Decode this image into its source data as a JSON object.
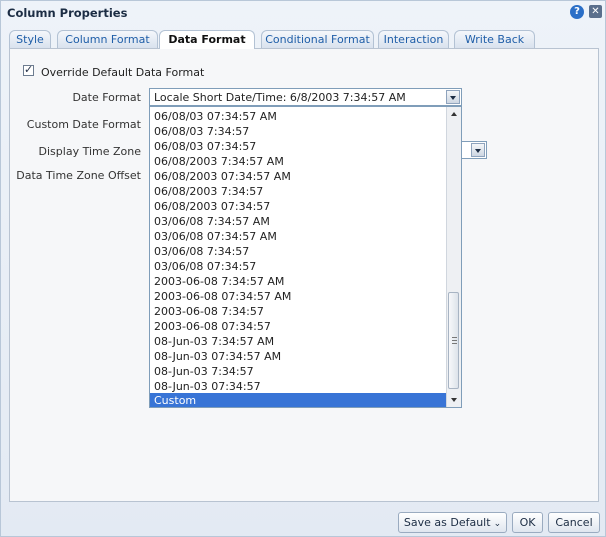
{
  "dialog": {
    "title": "Column Properties"
  },
  "tabs": [
    {
      "label": "Style"
    },
    {
      "label": "Column Format"
    },
    {
      "label": "Data Format"
    },
    {
      "label": "Conditional Format"
    },
    {
      "label": "Interaction"
    },
    {
      "label": "Write Back"
    }
  ],
  "active_tab": "Data Format",
  "override": {
    "label": "Override Default Data Format",
    "checked": true
  },
  "fields": {
    "date_format_label": "Date Format",
    "custom_date_format_label": "Custom Date Format",
    "display_time_zone_label": "Display Time Zone",
    "data_time_zone_offset_label": "Data Time Zone Offset"
  },
  "date_format": {
    "selected": "Locale Short Date/Time: 6/8/2003 7:34:57 AM"
  },
  "dropdown": {
    "options": [
      "06/08/03 07:34:57 AM",
      "06/08/03 7:34:57",
      "06/08/03 07:34:57",
      "06/08/2003 7:34:57 AM",
      "06/08/2003 07:34:57 AM",
      "06/08/2003 7:34:57",
      "06/08/2003 07:34:57",
      "03/06/08 7:34:57 AM",
      "03/06/08 07:34:57 AM",
      "03/06/08 7:34:57",
      "03/06/08 07:34:57",
      "2003-06-08 7:34:57 AM",
      "2003-06-08 07:34:57 AM",
      "2003-06-08 7:34:57",
      "2003-06-08 07:34:57",
      "08-Jun-03 7:34:57 AM",
      "08-Jun-03 07:34:57 AM",
      "08-Jun-03 7:34:57",
      "08-Jun-03 07:34:57",
      "Custom"
    ],
    "highlighted": "Custom"
  },
  "buttons": {
    "save_default": "Save as Default",
    "ok": "OK",
    "cancel": "Cancel"
  },
  "icons": {
    "help": "help-icon",
    "close": "close-icon"
  },
  "colors": {
    "highlight": "#3874d6",
    "tab_text": "#1f5ea8"
  }
}
